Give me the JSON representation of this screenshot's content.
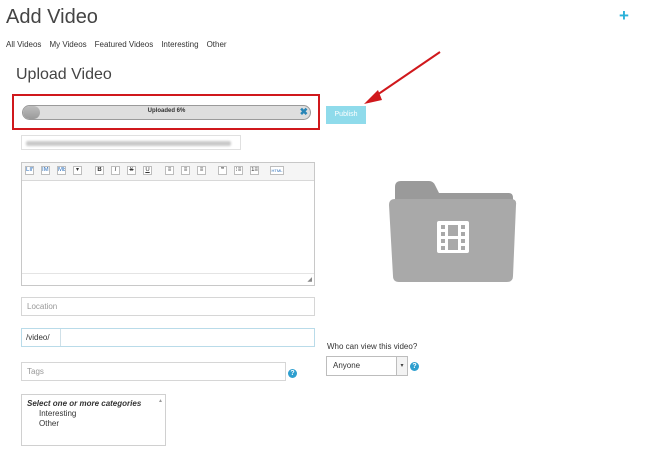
{
  "header": {
    "title": "Add Video",
    "add_icon": "plus-icon",
    "add_glyph": "+"
  },
  "nav": {
    "items": [
      "All Videos",
      "My Videos",
      "Featured Videos",
      "Interesting",
      "Other"
    ]
  },
  "section": {
    "title": "Upload Video"
  },
  "upload": {
    "label": "Uploaded 6%",
    "progress": 0.06,
    "cancel_glyph": "✖"
  },
  "publish": {
    "label": "Publish"
  },
  "editor": {
    "toolbar": [
      "LINK",
      "IMG",
      "MEDIA",
      "▾",
      "B",
      "I",
      "S",
      "U",
      "≡",
      "≡",
      "≡",
      "❝",
      "⁝≡",
      "1≡",
      "HTML"
    ]
  },
  "location": {
    "placeholder": "Location"
  },
  "url": {
    "prefix": "/video/"
  },
  "tags": {
    "placeholder": "Tags"
  },
  "help": {
    "glyph": "?"
  },
  "categories": {
    "heading": "Select one or more categories",
    "options": [
      "Interesting",
      "Other"
    ]
  },
  "visibility": {
    "label": "Who can view this video?",
    "selected": "Anyone",
    "arrow": "▾"
  },
  "colors": {
    "accent": "#2ab1d9",
    "publish": "#8fdbeb",
    "highlight": "#d0181c",
    "folder": "#a9a9a9"
  }
}
